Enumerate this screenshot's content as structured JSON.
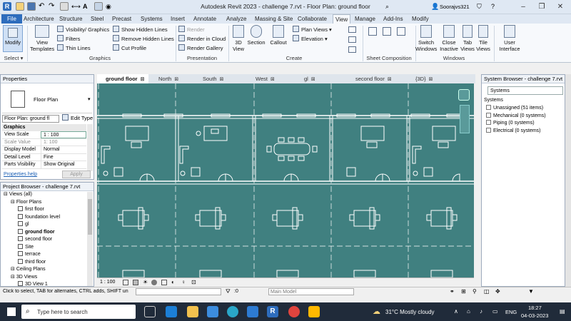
{
  "app": {
    "title": "Autodesk Revit 2023 - challenge 7.rvt - Floor Plan: ground floor",
    "user": "Soorajvs321"
  },
  "tabs": [
    "File",
    "Architecture",
    "Structure",
    "Steel",
    "Precast",
    "Systems",
    "Insert",
    "Annotate",
    "Analyze",
    "Massing & Site",
    "Collaborate",
    "View",
    "Manage",
    "Add-Ins",
    "Modify"
  ],
  "ribbon": {
    "select": {
      "modify": "Modify",
      "label": "Select ▾"
    },
    "graphics": {
      "view_templates": "View Templates",
      "visibility": "Visibility/ Graphics",
      "filters": "Filters",
      "thin_lines": "Thin Lines",
      "show_hidden": "Show Hidden Lines",
      "remove_hidden": "Remove Hidden Lines",
      "cut_profile": "Cut Profile",
      "label": "Graphics"
    },
    "presentation": {
      "render": "Render",
      "render_cloud": "Render in Cloud",
      "render_gallery": "Render Gallery",
      "label": "Presentation"
    },
    "create": {
      "view3d": "3D View",
      "section": "Section",
      "callout": "Callout",
      "plan_views": "Plan Views",
      "elevation": "Elevation",
      "label": "Create"
    },
    "sheet_comp": {
      "label": "Sheet Composition"
    },
    "windows": {
      "switch": "Switch Windows",
      "close_inactive": "Close Inactive",
      "tab_views": "Tab Views",
      "tile_views": "Tile Views",
      "label": "Windows"
    },
    "user_interface": "User Interface"
  },
  "properties": {
    "title": "Properties",
    "type_name": "Floor Plan",
    "instance": "Floor Plan: ground fl",
    "edit_type": "Edit Type",
    "section": "Graphics",
    "rows": [
      {
        "k": "View Scale",
        "v": "1 : 100"
      },
      {
        "k": "Scale Value",
        "v": "1:   100"
      },
      {
        "k": "Display Model",
        "v": "Normal"
      },
      {
        "k": "Detail Level",
        "v": "Fine"
      },
      {
        "k": "Parts Visibility",
        "v": "Show Original"
      }
    ],
    "help": "Properties help",
    "apply": "Apply"
  },
  "project_browser": {
    "title": "Project Browser - challenge 7.rvt",
    "items": [
      {
        "label": "Views (all)",
        "lvl": 0
      },
      {
        "label": "Floor Plans",
        "lvl": 1
      },
      {
        "label": "first floor",
        "lvl": 2
      },
      {
        "label": "foundation level",
        "lvl": 2
      },
      {
        "label": "gl",
        "lvl": 2
      },
      {
        "label": "ground floor",
        "lvl": 2,
        "bold": true
      },
      {
        "label": "second floor",
        "lvl": 2
      },
      {
        "label": "Site",
        "lvl": 2
      },
      {
        "label": "terrace",
        "lvl": 2
      },
      {
        "label": "third floor",
        "lvl": 2
      },
      {
        "label": "Ceiling Plans",
        "lvl": 1
      },
      {
        "label": "3D Views",
        "lvl": 1
      },
      {
        "label": "3D View 1",
        "lvl": 2
      }
    ]
  },
  "view_tabs": [
    {
      "label": "ground floor",
      "active": true
    },
    {
      "label": "North"
    },
    {
      "label": "South"
    },
    {
      "label": "West"
    },
    {
      "label": "gl"
    },
    {
      "label": "second floor"
    },
    {
      "label": "{3D}"
    }
  ],
  "system_browser": {
    "title": "System Browser - challenge 7.rvt",
    "dropdown": "Systems",
    "header": "Systems",
    "items": [
      "Unassigned (51 items)",
      "Mechanical (0 systems)",
      "Piping (0 systems)",
      "Electrical (0 systems)"
    ]
  },
  "view_control": {
    "scale": "1 : 100"
  },
  "status": {
    "hint": "Click to select, TAB for alternates, CTRL adds, SHIFT unse",
    "zero": ":0",
    "model": "Main Model"
  },
  "taskbar": {
    "search": "Type here to search",
    "weather": "31°C  Mostly cloudy",
    "lang": "ENG",
    "time": "18:27",
    "date": "04-03-2023"
  },
  "colors": {
    "canvas": "#408080",
    "accent": "#2e6dbd"
  }
}
